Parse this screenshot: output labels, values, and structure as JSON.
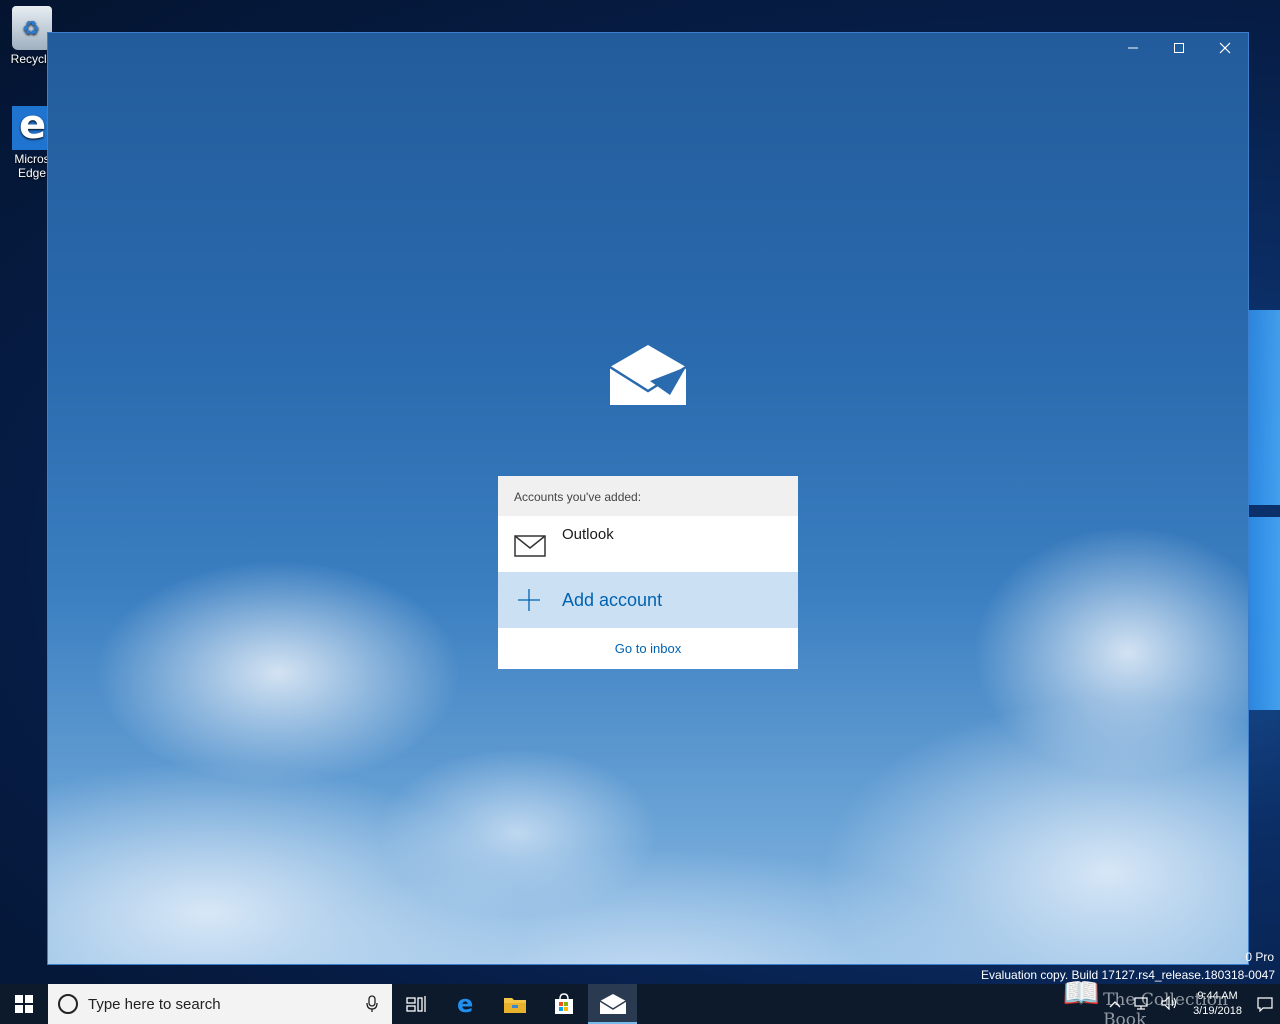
{
  "desktop": {
    "icons": [
      {
        "label": "Recycle",
        "icon": "recycle-bin-icon"
      },
      {
        "label": "Micros Edge",
        "line1": "Micros",
        "line2": "Edge",
        "icon": "edge-icon"
      }
    ],
    "watermark": {
      "edition": "0 Pro",
      "build": "Evaluation copy. Build 17127.rs4_release.180318-0047"
    }
  },
  "window": {
    "controls": [
      "minimize-icon",
      "maximize-icon",
      "close-icon"
    ],
    "app_logo": "mail-app-icon",
    "panel": {
      "header": "Accounts you've added:",
      "accounts": [
        {
          "name": "Outlook",
          "icon": "mail-envelope-icon"
        }
      ],
      "add_account": "Add account",
      "go_to_inbox": "Go to inbox"
    }
  },
  "taskbar": {
    "search_placeholder": "Type here to search",
    "pinned": [
      "task-view-icon",
      "edge-icon",
      "file-explorer-icon",
      "store-icon",
      "mail-icon"
    ],
    "clock": {
      "time": "9:44 AM",
      "date": "3/19/2018"
    },
    "overlay_text": "The Collection Book"
  },
  "colors": {
    "accent": "#0063b1",
    "add_row_bg": "#cce0f4",
    "taskbar_bg": "#0c1a2c"
  }
}
